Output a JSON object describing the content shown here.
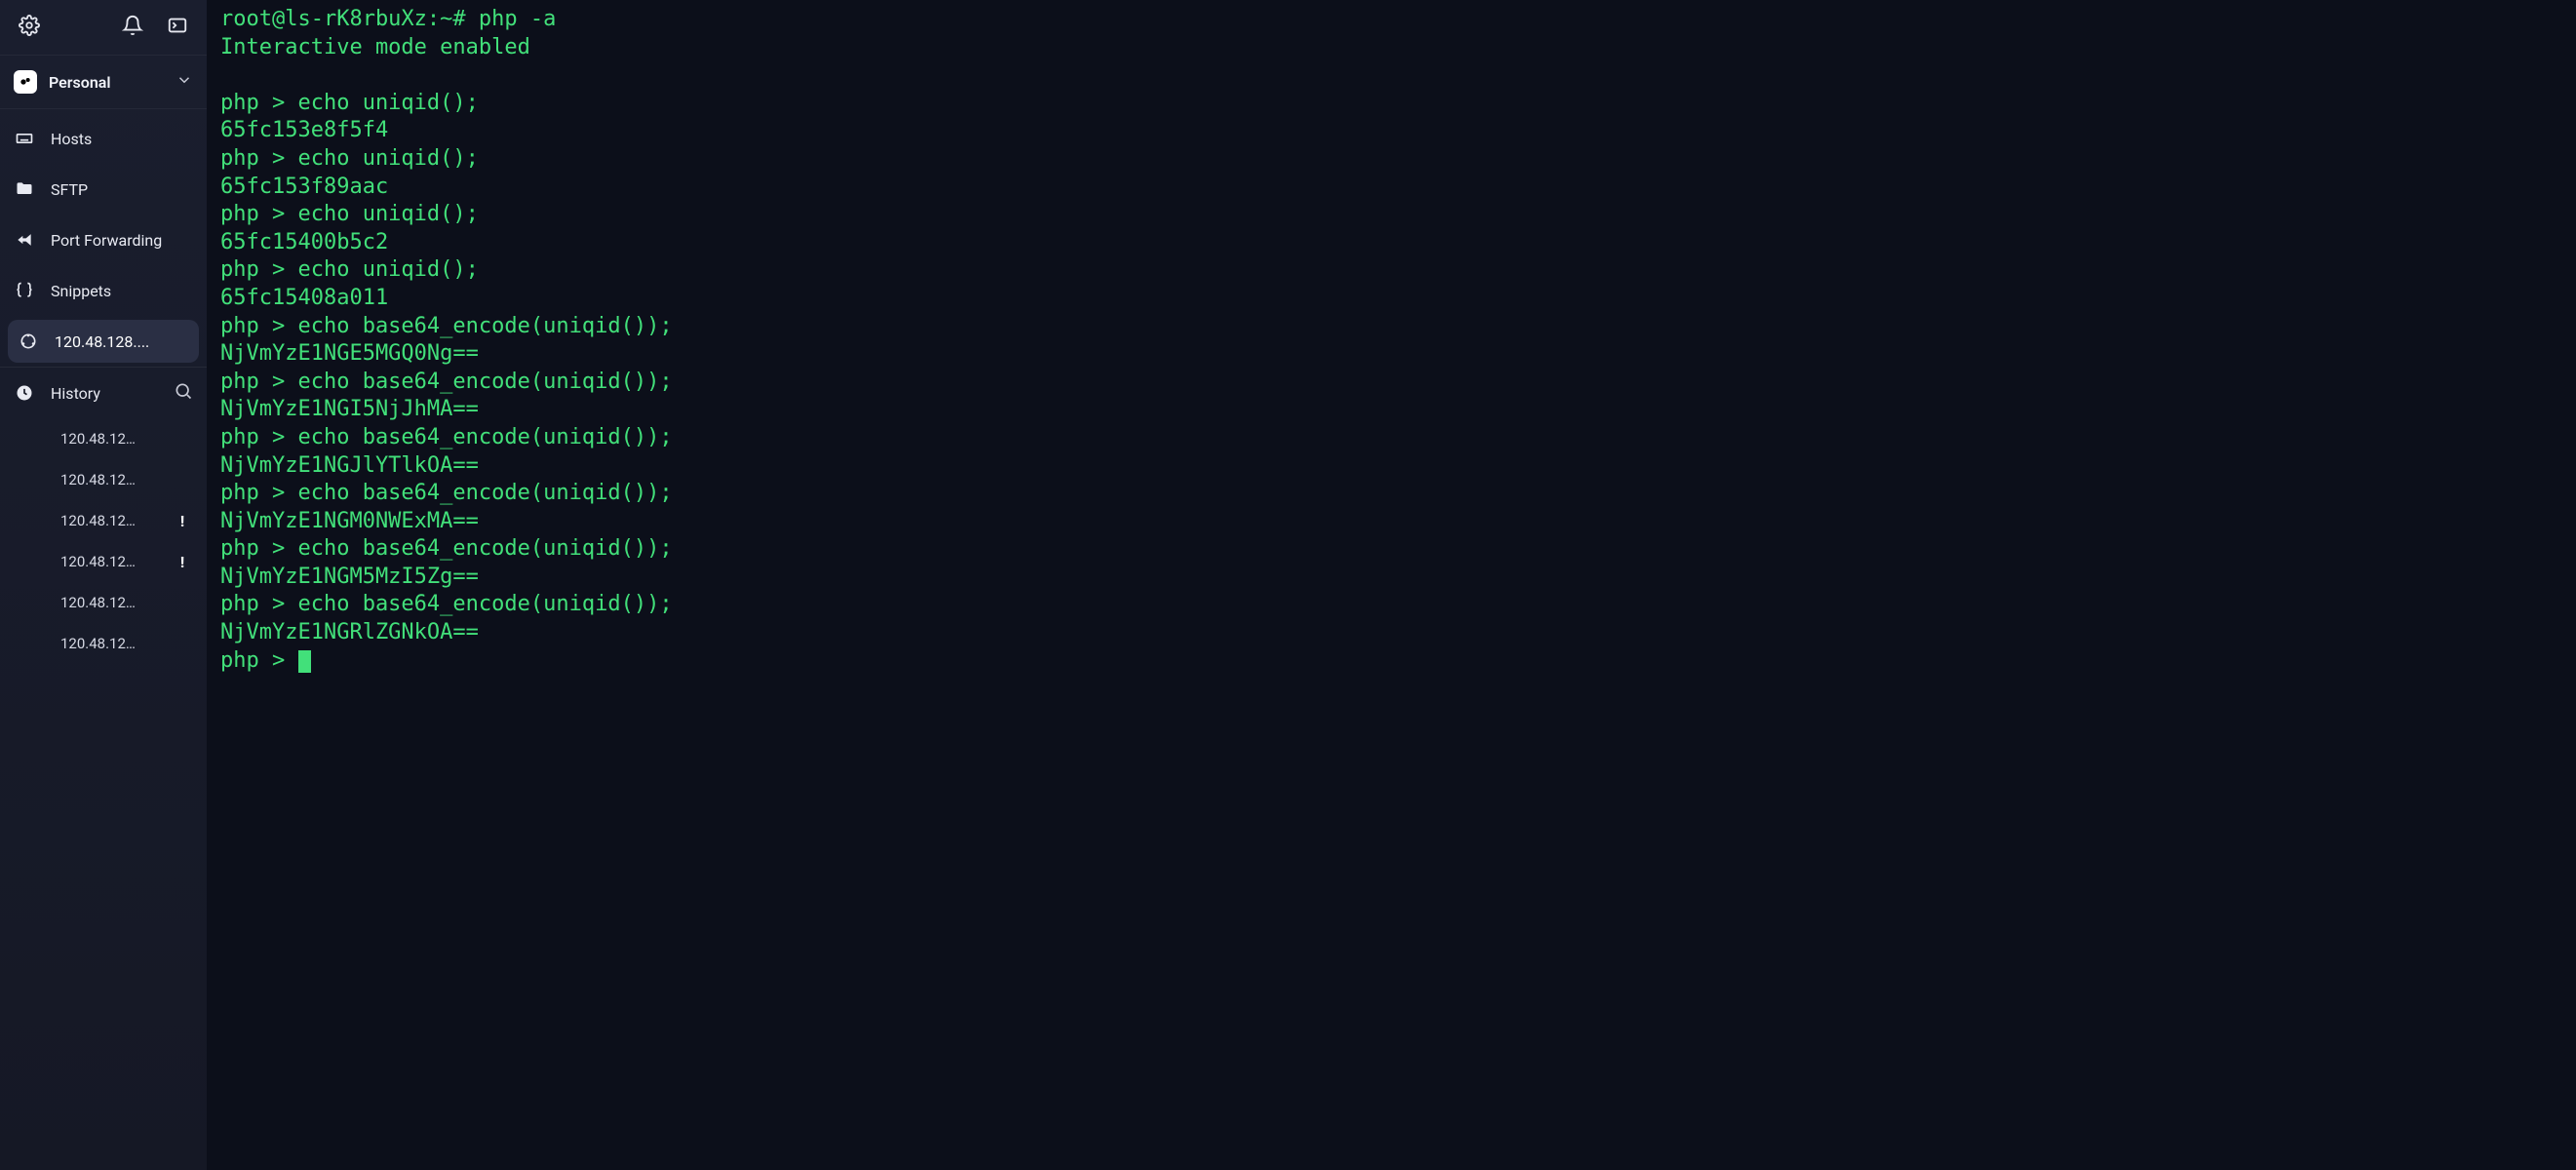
{
  "account": {
    "label": "Personal"
  },
  "nav": {
    "hosts": "Hosts",
    "sftp": "SFTP",
    "port_forwarding": "Port Forwarding",
    "snippets": "Snippets",
    "active_host": "120.48.128....",
    "history": "History"
  },
  "history": [
    {
      "label": "120.48.12…",
      "alert": false
    },
    {
      "label": "120.48.12…",
      "alert": false
    },
    {
      "label": "120.48.12…",
      "alert": true
    },
    {
      "label": "120.48.12…",
      "alert": true
    },
    {
      "label": "120.48.12…",
      "alert": false
    },
    {
      "label": "120.48.12…",
      "alert": false
    }
  ],
  "terminal": {
    "lines": [
      "root@ls-rK8rbuXz:~# php -a",
      "Interactive mode enabled",
      "",
      "php > echo uniqid();",
      "65fc153e8f5f4",
      "php > echo uniqid();",
      "65fc153f89aac",
      "php > echo uniqid();",
      "65fc15400b5c2",
      "php > echo uniqid();",
      "65fc15408a011",
      "php > echo base64_encode(uniqid());",
      "NjVmYzE1NGE5MGQ0Ng==",
      "php > echo base64_encode(uniqid());",
      "NjVmYzE1NGI5NjJhMA==",
      "php > echo base64_encode(uniqid());",
      "NjVmYzE1NGJlYTlkOA==",
      "php > echo base64_encode(uniqid());",
      "NjVmYzE1NGM0NWExMA==",
      "php > echo base64_encode(uniqid());",
      "NjVmYzE1NGM5MzI5Zg==",
      "php > echo base64_encode(uniqid());",
      "NjVmYzE1NGRlZGNkOA=="
    ],
    "prompt": "php > "
  }
}
